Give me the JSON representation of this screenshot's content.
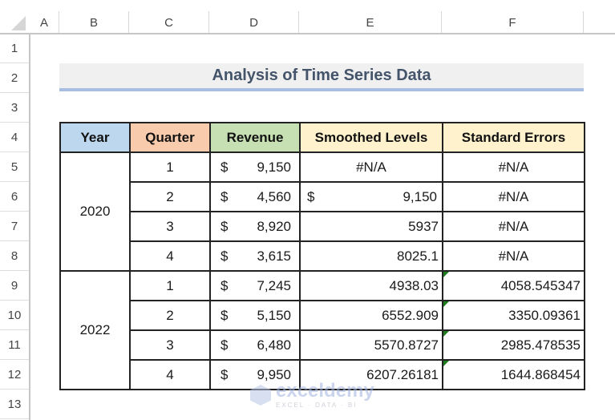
{
  "sheet": {
    "column_headers": [
      "A",
      "B",
      "C",
      "D",
      "E",
      "F"
    ],
    "row_headers": [
      "1",
      "2",
      "3",
      "4",
      "5",
      "6",
      "7",
      "8",
      "9",
      "10",
      "11",
      "12",
      "13"
    ],
    "title": "Analysis of Time Series Data",
    "table": {
      "headers": {
        "year": "Year",
        "quarter": "Quarter",
        "revenue": "Revenue",
        "smoothed": "Smoothed Levels",
        "stderr": "Standard Errors"
      },
      "header_colors": {
        "year": "#bdd7ee",
        "quarter": "#f8cbad",
        "revenue": "#c6e0b4",
        "smoothed": "#fff2cc",
        "stderr": "#fff2cc"
      },
      "groups": [
        {
          "year": "2020",
          "rows": [
            {
              "quarter": "1",
              "currency": "$",
              "revenue": "9,150",
              "smoothed": "#N/A",
              "stderr": "#N/A"
            },
            {
              "quarter": "2",
              "currency": "$",
              "revenue": "4,560",
              "smoothed_currency": "$",
              "smoothed": "9,150",
              "stderr": "#N/A"
            },
            {
              "quarter": "3",
              "currency": "$",
              "revenue": "8,920",
              "smoothed": "5937",
              "stderr": "#N/A"
            },
            {
              "quarter": "4",
              "currency": "$",
              "revenue": "3,615",
              "smoothed": "8025.1",
              "stderr": "#N/A"
            }
          ]
        },
        {
          "year": "2022",
          "rows": [
            {
              "quarter": "1",
              "currency": "$",
              "revenue": "7,245",
              "smoothed": "4938.03",
              "stderr": "4058.545347"
            },
            {
              "quarter": "2",
              "currency": "$",
              "revenue": "5,150",
              "smoothed": "6552.909",
              "stderr": "3350.09361"
            },
            {
              "quarter": "3",
              "currency": "$",
              "revenue": "6,480",
              "smoothed": "5570.8727",
              "stderr": "2985.478535"
            },
            {
              "quarter": "4",
              "currency": "$",
              "revenue": "9,950",
              "smoothed": "6207.26181",
              "stderr": "1644.868454"
            }
          ]
        }
      ]
    }
  },
  "watermark": {
    "name": "exceldemy",
    "tagline": "EXCEL · DATA · BI"
  }
}
